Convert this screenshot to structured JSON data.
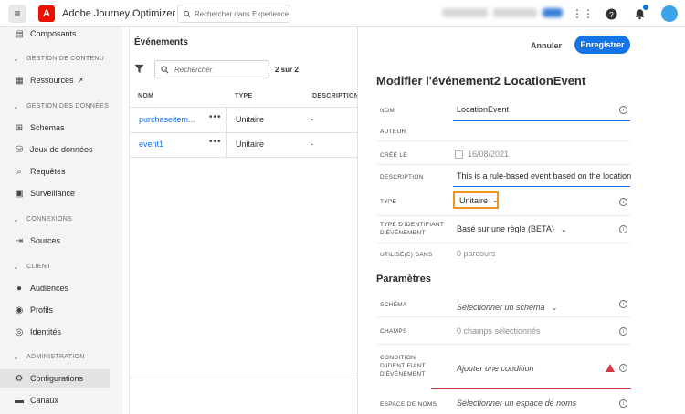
{
  "app": {
    "title": "Adobe Journey Optimizer",
    "logo_letter": "A",
    "search_placeholder": "Rechercher dans Experience Cl..."
  },
  "sidebar": {
    "items": [
      {
        "label": "Composants",
        "icon": "components-icon"
      },
      {
        "label": "Ressources",
        "icon": "assets-icon",
        "external": true
      },
      {
        "label": "Schémas",
        "icon": "schema-icon"
      },
      {
        "label": "Jeux de données",
        "icon": "datasets-icon"
      },
      {
        "label": "Requêtes",
        "icon": "queries-icon"
      },
      {
        "label": "Surveillance",
        "icon": "monitoring-icon"
      },
      {
        "label": "Sources",
        "icon": "sources-icon"
      },
      {
        "label": "Audiences",
        "icon": "audiences-icon"
      },
      {
        "label": "Profils",
        "icon": "profiles-icon"
      },
      {
        "label": "Identités",
        "icon": "identities-icon"
      },
      {
        "label": "Configurations",
        "icon": "gear-icon",
        "selected": true
      },
      {
        "label": "Canaux",
        "icon": "channels-icon"
      }
    ],
    "sections": [
      "GESTION DE CONTENU",
      "GESTION DES DONNÉES",
      "CONNEXIONS",
      "CLIENT",
      "ADMINISTRATION"
    ]
  },
  "list": {
    "title": "Événements",
    "search_placeholder": "Rechercher",
    "count": "2 sur 2",
    "columns": [
      "NOM",
      "TYPE",
      "DESCRIPTION"
    ],
    "rows": [
      {
        "name": "purchaseitem...",
        "type": "Unitaire",
        "description": "-"
      },
      {
        "name": "event1",
        "type": "Unitaire",
        "description": "-"
      }
    ]
  },
  "panel": {
    "cancel": "Annuler",
    "save": "Enregistrer",
    "title": "Modifier l'événement2 LocationEvent",
    "fields": {
      "name_label": "NOM",
      "name_value": "LocationEvent",
      "author_label": "AUTEUR",
      "created_label": "CRÉÉ LE",
      "created_value": "16/08/2021",
      "description_label": "DESCRIPTION",
      "description_value": "This is a rule-based event based on the location",
      "type_label": "TYPE",
      "type_value": "Unitaire",
      "idtype_label_1": "TYPE D'IDENTIFIANT",
      "idtype_label_2": "D'ÉVÉNEMENT",
      "idtype_value": "Basé sur une règle (BETA)",
      "usedin_label": "UTILISÉ(E) DANS",
      "usedin_value": "0 parcours"
    },
    "params_title": "Paramètres",
    "params": {
      "schema_label": "SCHÉMA",
      "schema_value": "Sélectionner un schéma",
      "fields_label": "CHAMPS",
      "fields_value": "0 champs sélectionnés",
      "cond_label_1": "CONDITION",
      "cond_label_2": "D'IDENTIFIANT",
      "cond_label_3": "D'ÉVÉNEMENT",
      "cond_value": "Ajouter une condition",
      "ns_label": "ESPACE DE NOMS",
      "ns_value": "Sélectionner un espace de noms"
    }
  },
  "colors": {
    "accent": "#1473e6",
    "warning": "#d7373f",
    "highlight": "#f29423",
    "brand": "#eb1000"
  }
}
